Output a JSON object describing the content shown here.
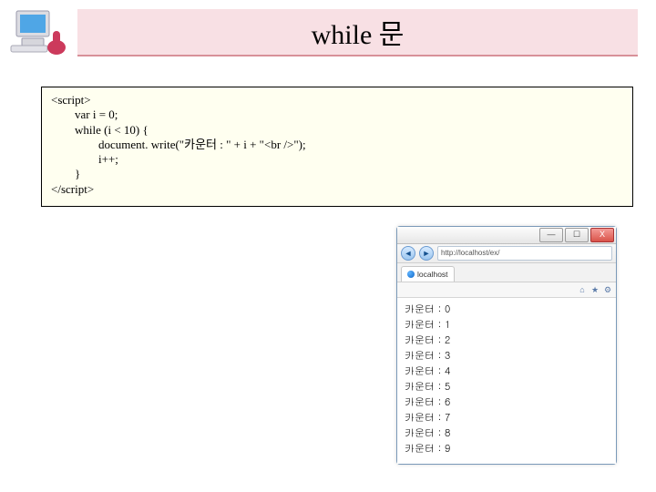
{
  "header": {
    "title": "while 문"
  },
  "code": {
    "lines": [
      {
        "indent": "l1",
        "text": "<script>"
      },
      {
        "indent": "l2",
        "text": "var i = 0;"
      },
      {
        "indent": "l2",
        "text": "while (i < 10) {"
      },
      {
        "indent": "l3",
        "text": "document. write(\"카운터 : \" + i + \"<br />\");"
      },
      {
        "indent": "l3",
        "text": "i++;"
      },
      {
        "indent": "l2",
        "text": "}"
      },
      {
        "indent": "l1",
        "text": "</script>"
      }
    ]
  },
  "browser": {
    "win": {
      "min": "—",
      "max": "☐",
      "close": "X"
    },
    "nav": {
      "back": "◄",
      "fwd": "►"
    },
    "url": "http://localhost/ex/",
    "tab": "localhost",
    "output_label": "카운터",
    "output_sep": " : ",
    "output_values": [
      0,
      1,
      2,
      3,
      4,
      5,
      6,
      7,
      8,
      9
    ]
  }
}
